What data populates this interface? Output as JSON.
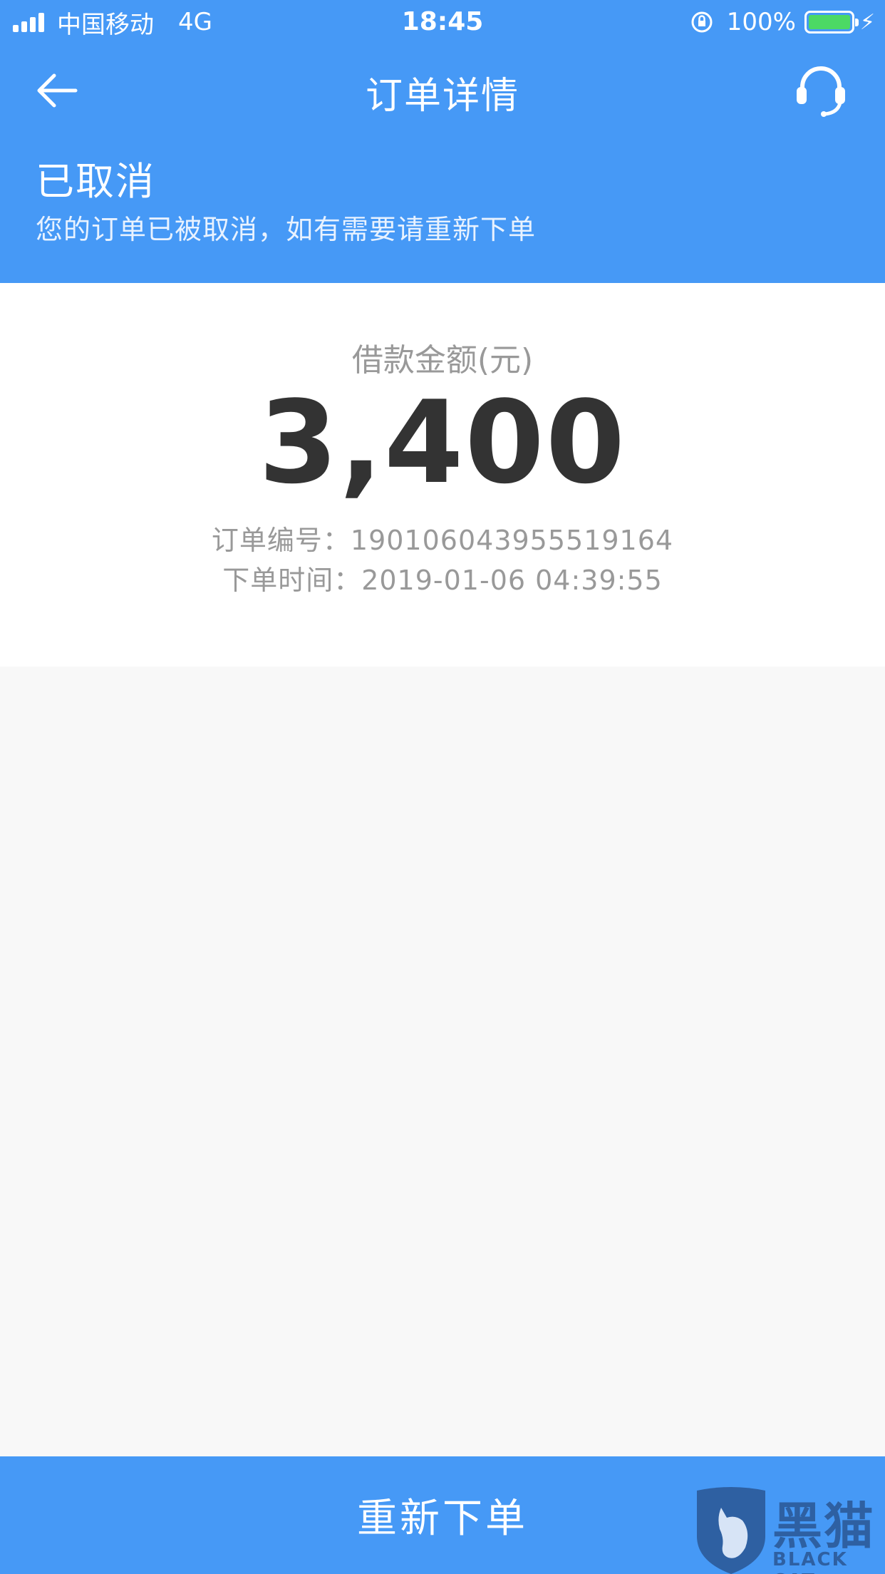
{
  "status_bar": {
    "carrier": "中国移动",
    "network": "4G",
    "time": "18:45",
    "battery": "100%"
  },
  "nav": {
    "title": "订单详情"
  },
  "order_status": {
    "title": "已取消",
    "description": "您的订单已被取消，如有需要请重新下单"
  },
  "loan": {
    "amount_label": "借款金额(元)",
    "amount": "3,400",
    "order_no": "订单编号：190106043955519164",
    "order_time": "下单时间：2019-01-06 04:39:55"
  },
  "actions": {
    "reorder_label": "重新下单"
  },
  "watermark": {
    "text": "黑猫",
    "sub": "BLACK CAT"
  },
  "colors": {
    "primary": "#4699f6",
    "amount": "#333333",
    "muted": "#999999",
    "battery": "#4cd964"
  }
}
